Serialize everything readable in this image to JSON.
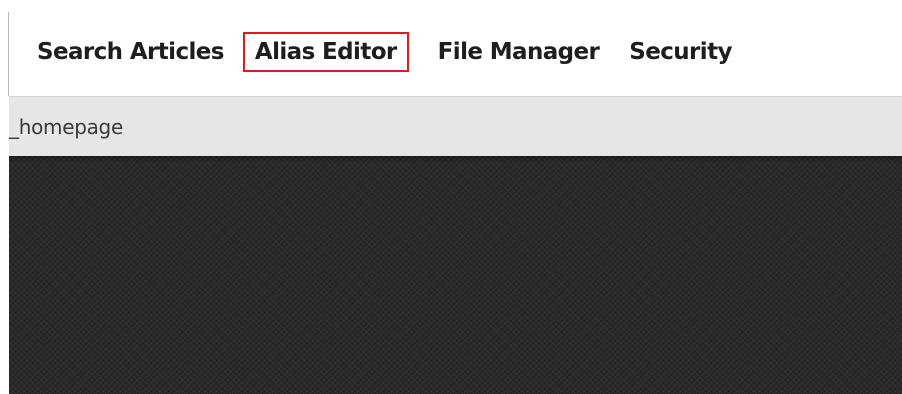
{
  "nav": {
    "items": [
      {
        "label": "Search Articles"
      },
      {
        "label": "Alias Editor",
        "highlighted": true
      },
      {
        "label": "File Manager"
      },
      {
        "label": "Security"
      }
    ]
  },
  "path": {
    "text": "_homepage"
  },
  "colors": {
    "highlight_border": "#e01b1b",
    "path_bar_bg": "#e6e6e6",
    "content_bg": "#2a2a2a"
  }
}
